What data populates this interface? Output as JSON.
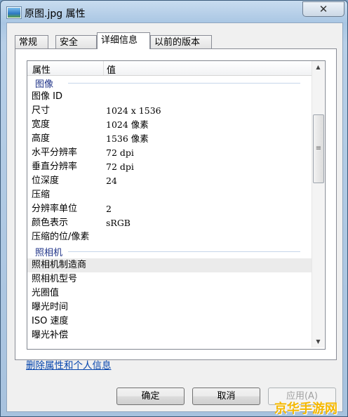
{
  "window": {
    "title": "原图.jpg 属性",
    "close_symbol": "✕"
  },
  "tabs": [
    {
      "label": "常规",
      "active": false
    },
    {
      "label": "安全",
      "active": false
    },
    {
      "label": "详细信息",
      "active": true
    },
    {
      "label": "以前的版本",
      "active": false
    }
  ],
  "table": {
    "col_property": "属性",
    "col_value": "值",
    "group_image": "图像",
    "image_rows": [
      {
        "k": "图像 ID",
        "v": ""
      },
      {
        "k": "尺寸",
        "v": "1024 x 1536"
      },
      {
        "k": "宽度",
        "v": "1024 像素"
      },
      {
        "k": "高度",
        "v": "1536 像素"
      },
      {
        "k": "水平分辨率",
        "v": "72 dpi"
      },
      {
        "k": "垂直分辨率",
        "v": "72 dpi"
      },
      {
        "k": "位深度",
        "v": "24"
      },
      {
        "k": "压缩",
        "v": ""
      },
      {
        "k": "分辨率单位",
        "v": "2"
      },
      {
        "k": "颜色表示",
        "v": "sRGB"
      },
      {
        "k": "压缩的位/像素",
        "v": ""
      }
    ],
    "group_camera": "照相机",
    "camera_rows": [
      {
        "k": "照相机制造商",
        "v": ""
      },
      {
        "k": "照相机型号",
        "v": ""
      },
      {
        "k": "光圈值",
        "v": ""
      },
      {
        "k": "曝光时间",
        "v": ""
      },
      {
        "k": "ISO 速度",
        "v": ""
      },
      {
        "k": "曝光补偿",
        "v": ""
      }
    ],
    "scroll_grip": "≡"
  },
  "link": "删除属性和个人信息",
  "buttons": {
    "ok": "确定",
    "cancel": "取消",
    "apply": "应用(A)"
  },
  "watermark": "京华手游网"
}
